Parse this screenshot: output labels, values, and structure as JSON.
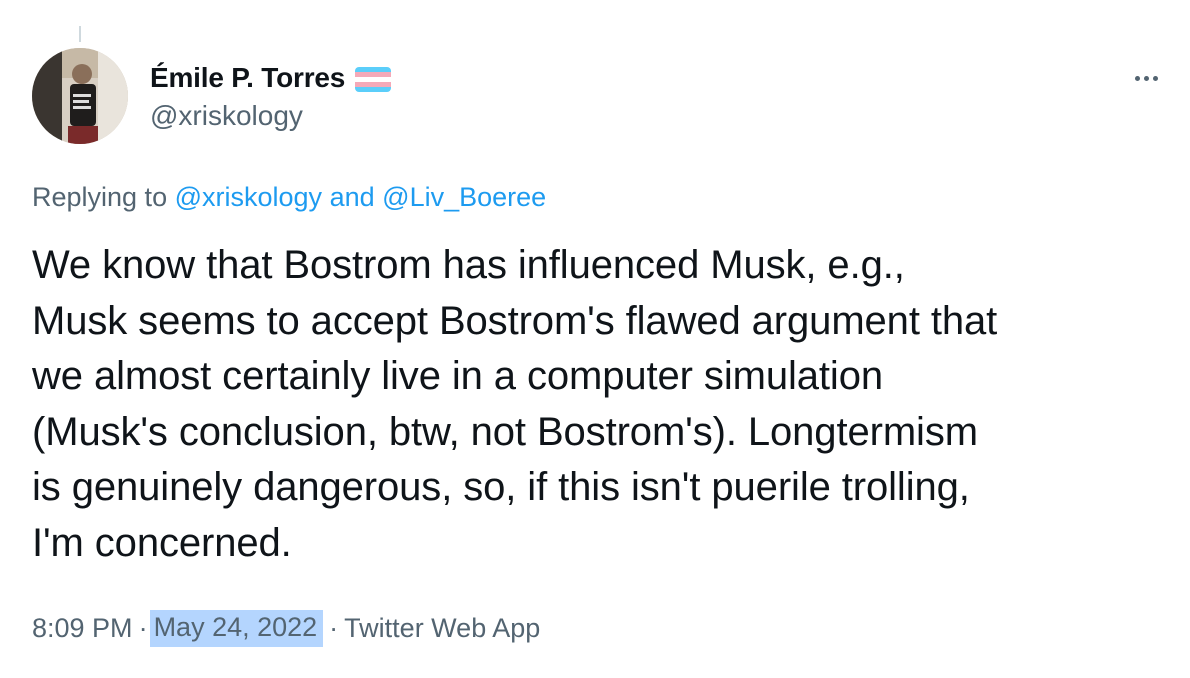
{
  "author": {
    "display_name": "Émile P. Torres",
    "handle": "@xriskology",
    "flag_icon": "transgender-flag-icon",
    "flag_colors": [
      "#5bcefa",
      "#f5a9b8",
      "#ffffff",
      "#f5a9b8",
      "#5bcefa"
    ]
  },
  "more_icon": "more-horizontal-icon",
  "replying": {
    "prefix": "Replying to",
    "mention_1": "@xriskology",
    "conjunction": "and",
    "mention_2": "@Liv_Boeree"
  },
  "tweet": {
    "lines": [
      "We know that Bostrom has influenced Musk, e.g.,",
      "Musk seems to accept Bostrom's flawed argument that",
      "we almost certainly live in a computer simulation",
      "(Musk's conclusion, btw, not Bostrom's). Longtermism",
      "is genuinely dangerous, so, if this isn't puerile trolling,",
      "I'm concerned."
    ]
  },
  "meta": {
    "time": "8:09 PM",
    "separator": "·",
    "date": "May 24, 2022",
    "source": "Twitter Web App"
  },
  "colors": {
    "text": "#0f1419",
    "secondary": "#536471",
    "link": "#1d9bf0",
    "selection": "#b4d5fe"
  }
}
